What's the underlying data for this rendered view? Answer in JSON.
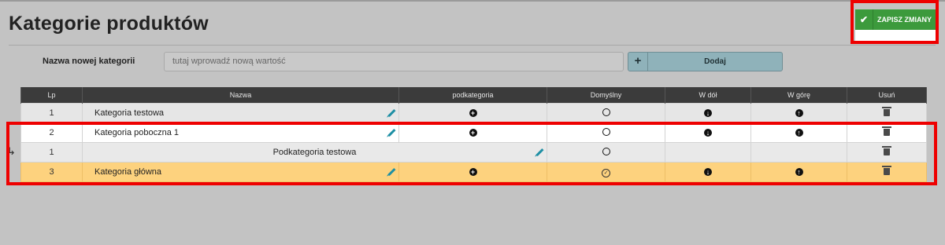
{
  "page": {
    "title": "Kategorie produktów"
  },
  "toolbar": {
    "save_label": "ZAPISZ ZMIANY"
  },
  "new_category": {
    "label": "Nazwa nowej kategorii",
    "placeholder": "tutaj wprowadź nową wartość",
    "add_label": "Dodaj",
    "add_symbol": "+"
  },
  "table": {
    "headers": [
      "Lp",
      "Nazwa",
      "podkategoria",
      "Domyślny",
      "W dół",
      "W górę",
      "Usuń"
    ],
    "rows": [
      {
        "lp": "1",
        "name": "Kategoria testowa"
      },
      {
        "lp": "2",
        "name": "Kategoria poboczna 1"
      },
      {
        "lp": "1",
        "name": "Podkategoria testowa"
      },
      {
        "lp": "3",
        "name": "Kategoria główna"
      }
    ]
  },
  "colors": {
    "accent_green": "#3c9a3c",
    "highlight_red": "#ee0000",
    "row_selected": "#fdd27e",
    "pencil": "#1e8fa4"
  },
  "icons": [
    "check-icon",
    "plus-icon",
    "pencil-icon",
    "plus-circle-icon",
    "radio-icon",
    "arrow-down-icon",
    "arrow-up-icon",
    "trash-icon",
    "sub-arrow-icon"
  ]
}
